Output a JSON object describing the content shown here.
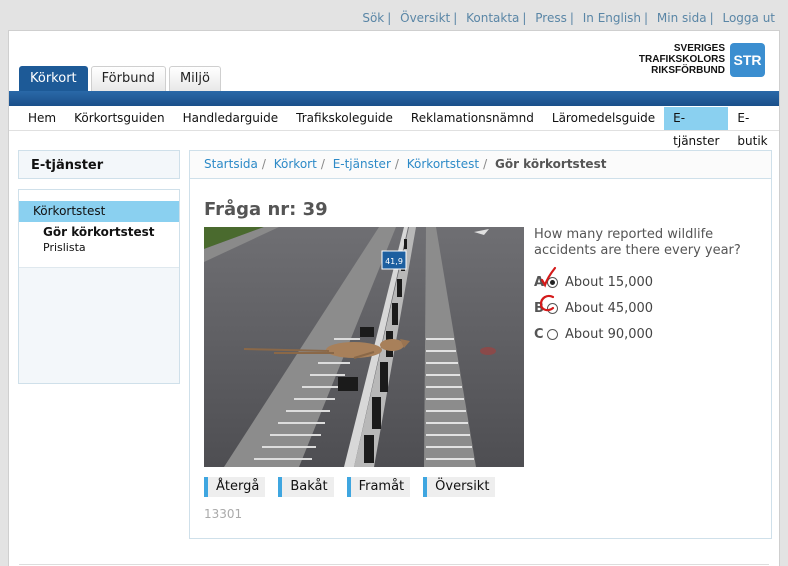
{
  "toplinks": [
    "Sök",
    "Översikt",
    "Kontakta",
    "Press",
    "In English",
    "Min sida",
    "Logga ut"
  ],
  "logo": {
    "line1": "SVERIGES",
    "line2": "TRAFIKSKOLORS",
    "line3": "RIKSFÖRBUND",
    "badge": "STR"
  },
  "tabs": [
    {
      "label": "Körkort",
      "active": true
    },
    {
      "label": "Förbund",
      "active": false
    },
    {
      "label": "Miljö",
      "active": false
    }
  ],
  "nav": [
    {
      "label": "Hem"
    },
    {
      "label": "Körkortsguiden"
    },
    {
      "label": "Handledarguide"
    },
    {
      "label": "Trafikskoleguide"
    },
    {
      "label": "Reklamationsnämnd"
    },
    {
      "label": "Läromedelsguide"
    },
    {
      "label": "E-tjänster",
      "active": true
    },
    {
      "label": "E-butik"
    }
  ],
  "sidebar": {
    "title": "E-tjänster",
    "items": [
      {
        "label": "Körkortstest"
      },
      {
        "label": "Gör körkortstest"
      },
      {
        "label": "Prislista"
      }
    ]
  },
  "breadcrumb": [
    "Startsida",
    "Körkort",
    "E-tjänster",
    "Körkortstest",
    "Gör körkortstest"
  ],
  "question": {
    "title": "Fråga nr: 39",
    "text": "How many reported wildlife accidents are there every year?",
    "options": [
      {
        "letter": "A",
        "label": "About 15,000",
        "checked": true
      },
      {
        "letter": "B",
        "label": "About 45,000",
        "checked": false
      },
      {
        "letter": "C",
        "label": "About 90,000",
        "checked": false
      }
    ],
    "sign_text": "41,9"
  },
  "buttons": [
    "Återgå",
    "Bakåt",
    "Framåt",
    "Översikt"
  ],
  "question_id": "13301",
  "colors": {
    "accent": "#1d5a97",
    "highlight": "#8ad0f0",
    "link": "#2d8ac7",
    "mark": "#d41a1a"
  }
}
